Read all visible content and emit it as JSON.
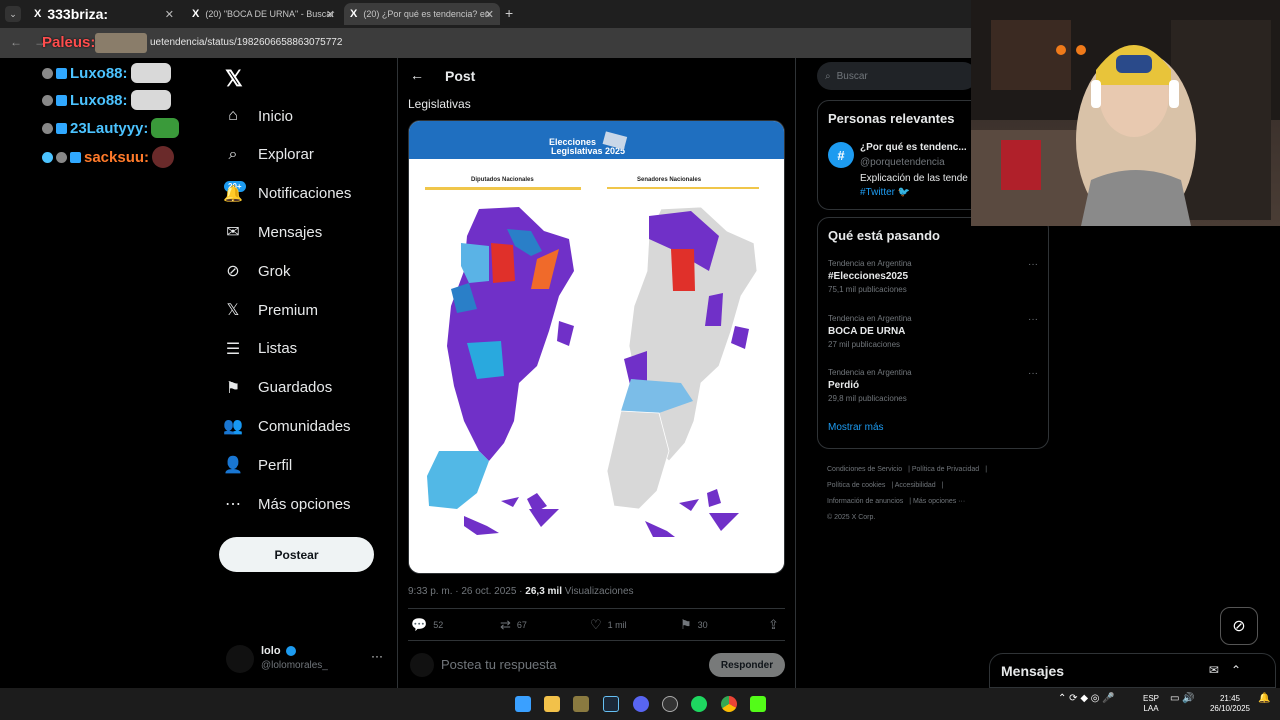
{
  "browser": {
    "tabs": [
      {
        "label": "333briza:",
        "active": false
      },
      {
        "label": "(20) \"BOCA DE URNA\" - Buscar",
        "active": false
      },
      {
        "label": "(20) ¿Por qué es tendencia? en",
        "active": true
      }
    ],
    "url": "uetendencia/status/1982606658863075772"
  },
  "chat_overlay": [
    {
      "user": "Paleus:"
    },
    {
      "user": "Luxo88:"
    },
    {
      "user": "Luxo88:"
    },
    {
      "user": "23Lautyyy:"
    },
    {
      "user": "sacksuu:"
    }
  ],
  "sidebar": {
    "notif_badge": "20+",
    "items": [
      {
        "label": "Inicio",
        "icon": "home-icon"
      },
      {
        "label": "Explorar",
        "icon": "search-icon"
      },
      {
        "label": "Notificaciones",
        "icon": "bell-icon"
      },
      {
        "label": "Mensajes",
        "icon": "envelope-icon"
      },
      {
        "label": "Grok",
        "icon": "grok-icon"
      },
      {
        "label": "Premium",
        "icon": "x-logo-icon"
      },
      {
        "label": "Listas",
        "icon": "list-icon"
      },
      {
        "label": "Guardados",
        "icon": "bookmark-icon"
      },
      {
        "label": "Comunidades",
        "icon": "communities-icon"
      },
      {
        "label": "Perfil",
        "icon": "person-icon"
      },
      {
        "label": "Más opciones",
        "icon": "more-circle-icon"
      }
    ],
    "post_button": "Postear",
    "account": {
      "name": "lolo",
      "handle": "@lolomorales_"
    }
  },
  "post": {
    "header": "Post",
    "text": "Legislativas",
    "image": {
      "title_line1": "Elecciones",
      "title_line2": "Legislativas 2025",
      "left_label": "Diputados Nacionales",
      "right_label": "Senadores Nacionales"
    },
    "time": "9:33 p. m. · 26 oct. 2025 ·",
    "views": "26,3 mil",
    "views_label": "Visualizaciones",
    "actions": {
      "replies": "52",
      "reposts": "67",
      "likes": "1 mil",
      "bookmarks": "30"
    },
    "reply_placeholder": "Postea tu respuesta",
    "reply_button": "Responder"
  },
  "right": {
    "search_placeholder": "Buscar",
    "relevant_title": "Personas relevantes",
    "relevant": {
      "name": "¿Por qué es tendenc...",
      "handle": "@porquetendencia",
      "bio": "Explicación de las tende",
      "tag": "#Twitter"
    },
    "trends_title": "Qué está pasando",
    "trends": [
      {
        "context": "Tendencia en Argentina",
        "name": "#Elecciones2025",
        "count": "75,1 mil publicaciones"
      },
      {
        "context": "Tendencia en Argentina",
        "name": "BOCA DE URNA",
        "count": "27 mil publicaciones"
      },
      {
        "context": "Tendencia en Argentina",
        "name": "Perdió",
        "count": "29,8 mil publicaciones"
      }
    ],
    "show_more": "Mostrar más",
    "footer": [
      "Condiciones de Servicio",
      "Política de Privacidad",
      "Política de cookies",
      "Accesibilidad",
      "Información de anuncios",
      "Más opciones ···",
      "© 2025 X Corp."
    ]
  },
  "messages_dock": {
    "title": "Mensajes"
  },
  "taskbar": {
    "lang_top": "ESP",
    "lang_bottom": "LAA",
    "time": "21:45",
    "date": "26/10/2025"
  },
  "colors": {
    "purple": "#7030c8",
    "red": "#e0302a",
    "orange": "#f06a2a",
    "lightblue": "#5ab3e6",
    "blue": "#2a7fc8",
    "gray": "#d8d8d8",
    "accent": "#1d9bf0"
  }
}
